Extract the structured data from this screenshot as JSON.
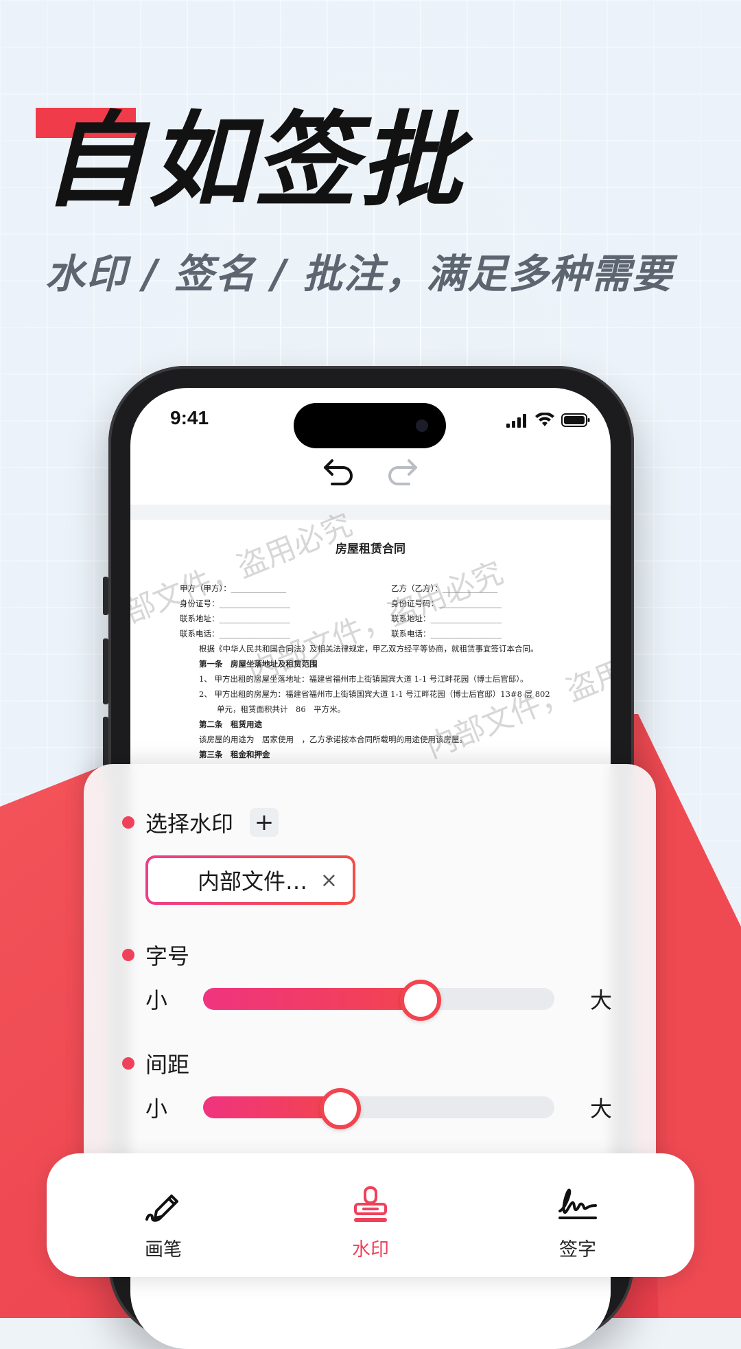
{
  "promo": {
    "headline": "自如签批",
    "subline": "水印 / 签名 / 批注，满足多种需要"
  },
  "status_bar": {
    "time": "9:41"
  },
  "document": {
    "title": "房屋租赁合同",
    "lines": [
      "甲方（甲方）：______________",
      "身份证号：__________________",
      "联系地址：__________________",
      "联系电话：__________________",
      "乙方（乙方）：______________",
      "身份证号码：________________",
      "联系地址：__________________",
      "联系电话：__________________",
      "根据《中华人民共和国合同法》及相关法律规定，甲乙双方经平等协商，就租赁事宜签订本合同。",
      "第一条　房屋坐落地址及租赁范围",
      "1、 甲方出租的房屋坐落地址：福建省福州市上街镇国宾大道 1-1 号江畔花园（博士后官邸）。",
      "2、 甲方出租的房屋为：福建省福州市上街镇国宾大道 1-1 号江畔花园（博士后官邸）13#8 层 802",
      "单元，租赁面积共计　86　平方米。",
      "第二条　租赁用途",
      "该房屋的用途为　居家使用　，乙方承诺按本合同所载明的用途使用该房屋。",
      "第三条　租金和押金"
    ],
    "watermark_text": "内部文件，盗用必究"
  },
  "panel": {
    "select_watermark": "选择水印",
    "add_label": "+",
    "chip_text": "内部文件…",
    "chip_close": "×",
    "font_size": {
      "title": "字号",
      "min_label": "小",
      "max_label": "大",
      "value": 0.62
    },
    "spacing": {
      "title": "间距",
      "min_label": "小",
      "max_label": "大",
      "value": 0.39
    }
  },
  "tabs": [
    {
      "label": "画笔",
      "icon": "pen-icon",
      "active": false
    },
    {
      "label": "水印",
      "icon": "stamp-icon",
      "active": true
    },
    {
      "label": "签字",
      "icon": "signature-icon",
      "active": false
    }
  ],
  "colors": {
    "accent": "#f0415b",
    "red_bg": "#ef4b52"
  }
}
